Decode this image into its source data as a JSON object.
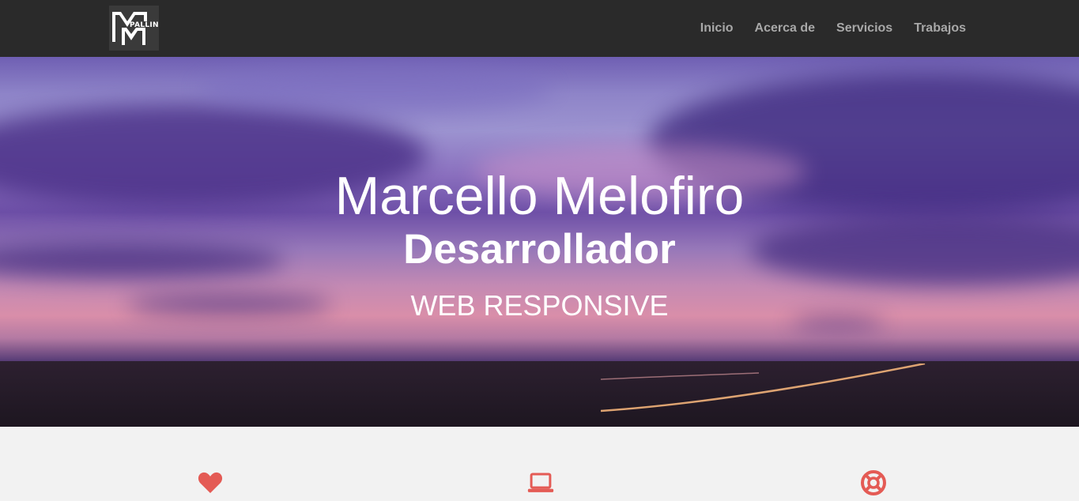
{
  "brand": {
    "logo_text": "PALLIN",
    "logo_icon": "m-logo-icon"
  },
  "nav": {
    "items": [
      {
        "label": "Inicio"
      },
      {
        "label": "Acerca de"
      },
      {
        "label": "Servicios"
      },
      {
        "label": "Trabajos"
      }
    ]
  },
  "hero": {
    "name": "Marcello Melofiro",
    "role": "Desarrollador",
    "tagline": "WEB RESPONSIVE"
  },
  "features": {
    "icons": [
      {
        "icon": "heart-icon"
      },
      {
        "icon": "laptop-icon"
      },
      {
        "icon": "life-ring-icon"
      }
    ]
  },
  "colors": {
    "navbar_bg": "#2a2a2a",
    "nav_text": "#a8a8a8",
    "accent": "#e45b55",
    "section_bg": "#f2f2f2"
  }
}
